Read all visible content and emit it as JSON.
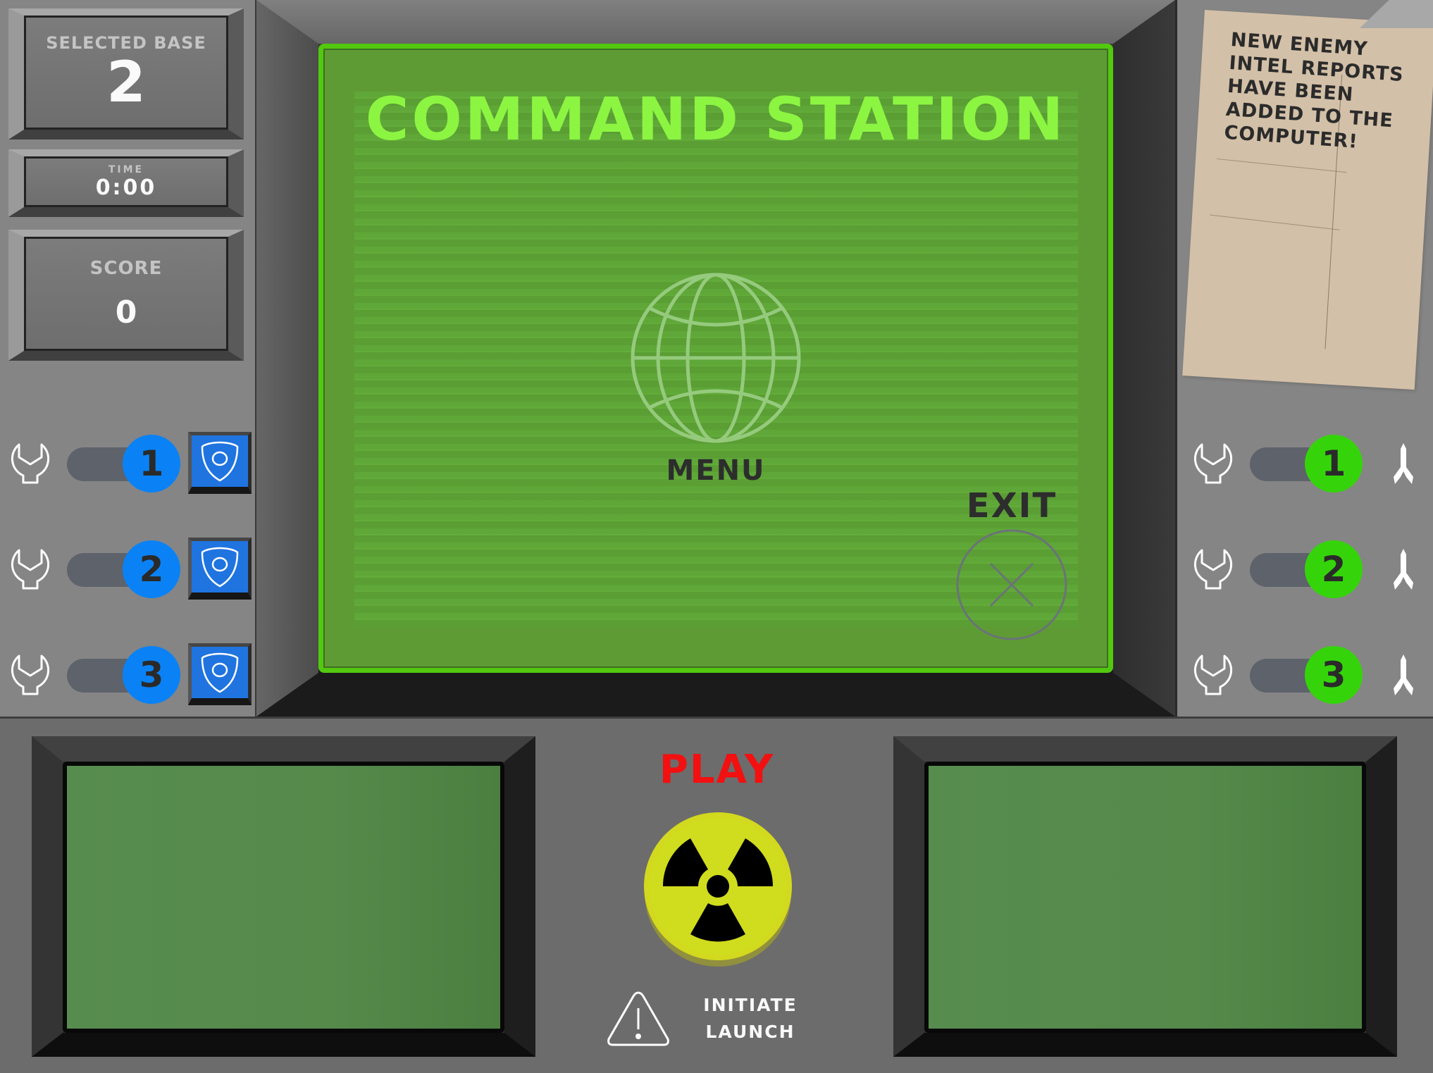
{
  "stats": {
    "selected_base_label": "SELECTED BASE",
    "selected_base_value": "2",
    "time_label": "TIME",
    "time_value": "0:00",
    "score_label": "SCORE",
    "score_value": "0"
  },
  "defense_bases": [
    {
      "number": "1",
      "icon": "wrench-icon",
      "action_icon": "shield-icon"
    },
    {
      "number": "2",
      "icon": "wrench-icon",
      "action_icon": "shield-icon"
    },
    {
      "number": "3",
      "icon": "wrench-icon",
      "action_icon": "shield-icon"
    }
  ],
  "missile_bases": [
    {
      "number": "1",
      "icon": "wrench-icon",
      "action_icon": "rocket-icon"
    },
    {
      "number": "2",
      "icon": "wrench-icon",
      "action_icon": "rocket-icon"
    },
    {
      "number": "3",
      "icon": "wrench-icon",
      "action_icon": "rocket-icon"
    }
  ],
  "main_screen": {
    "title": "COMMAND STATION",
    "menu_label": "MENU",
    "exit_label": "EXIT"
  },
  "note": {
    "text": "NEW ENEMY INTEL REPORTS HAVE BEEN ADDED TO THE COMPUTER!"
  },
  "launch": {
    "play_label": "PLAY",
    "initiate_line1": "INITIATE",
    "initiate_line2": "LAUNCH"
  },
  "colors": {
    "screen_green": "#5f9b35",
    "title_green": "#8cf542",
    "defense_blue": "#0a82f5",
    "missile_green": "#35d40a",
    "play_red": "#f21010",
    "hazard_yellow": "#d4e01a"
  }
}
